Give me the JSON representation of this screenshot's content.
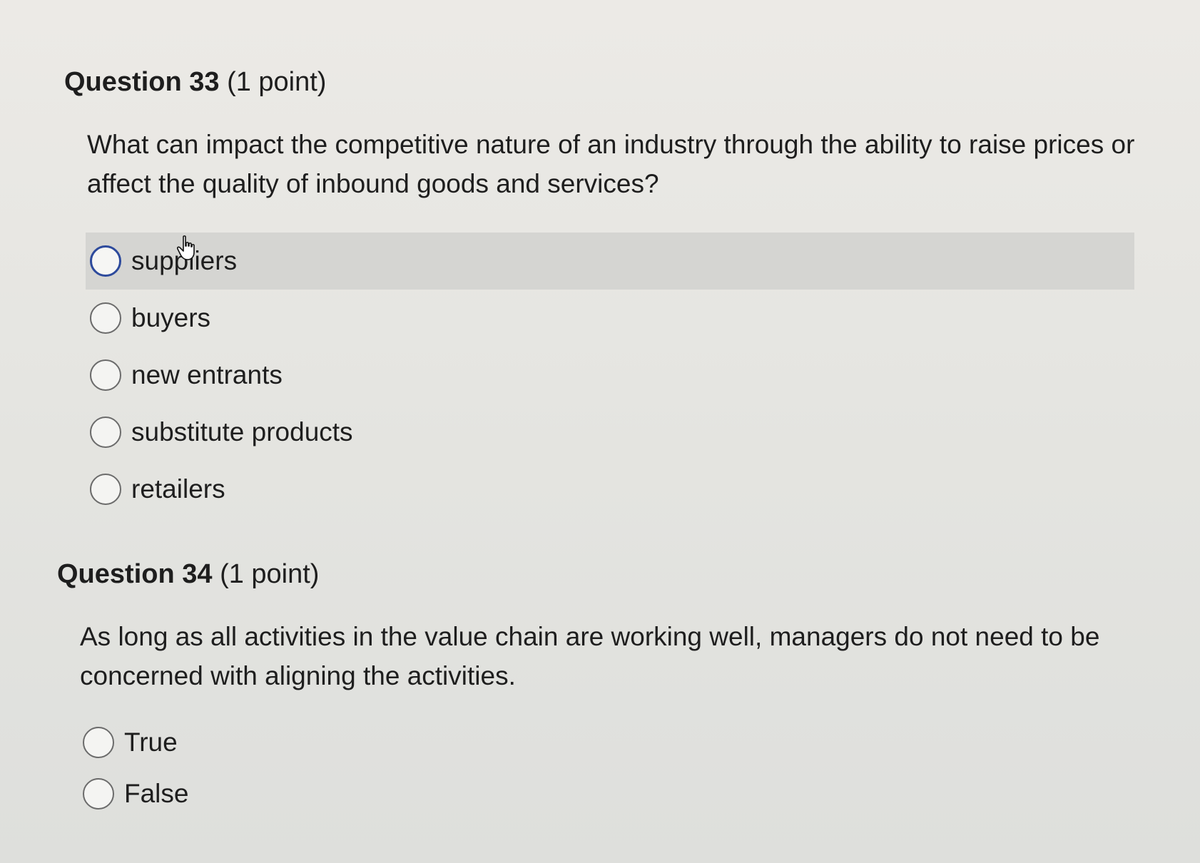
{
  "questions": [
    {
      "number": "Question 33",
      "points": "(1 point)",
      "prompt": "What can impact the competitive nature of an industry through the ability to raise prices or affect the quality of inbound goods and services?",
      "options": [
        {
          "label": "suppliers",
          "highlighted": true
        },
        {
          "label": "buyers"
        },
        {
          "label": "new entrants"
        },
        {
          "label": "substitute products"
        },
        {
          "label": "retailers"
        }
      ]
    },
    {
      "number": "Question 34",
      "points": "(1 point)",
      "prompt": "As long as all activities in the value chain are working well, managers do not need to be concerned with aligning the activities.",
      "options": [
        {
          "label": "True"
        },
        {
          "label": "False"
        }
      ]
    }
  ],
  "colors": {
    "highlight_row": "#d5d5d2",
    "focused_radio": "#2d4a9c"
  },
  "cursor_icon": "hand-pointer-icon"
}
